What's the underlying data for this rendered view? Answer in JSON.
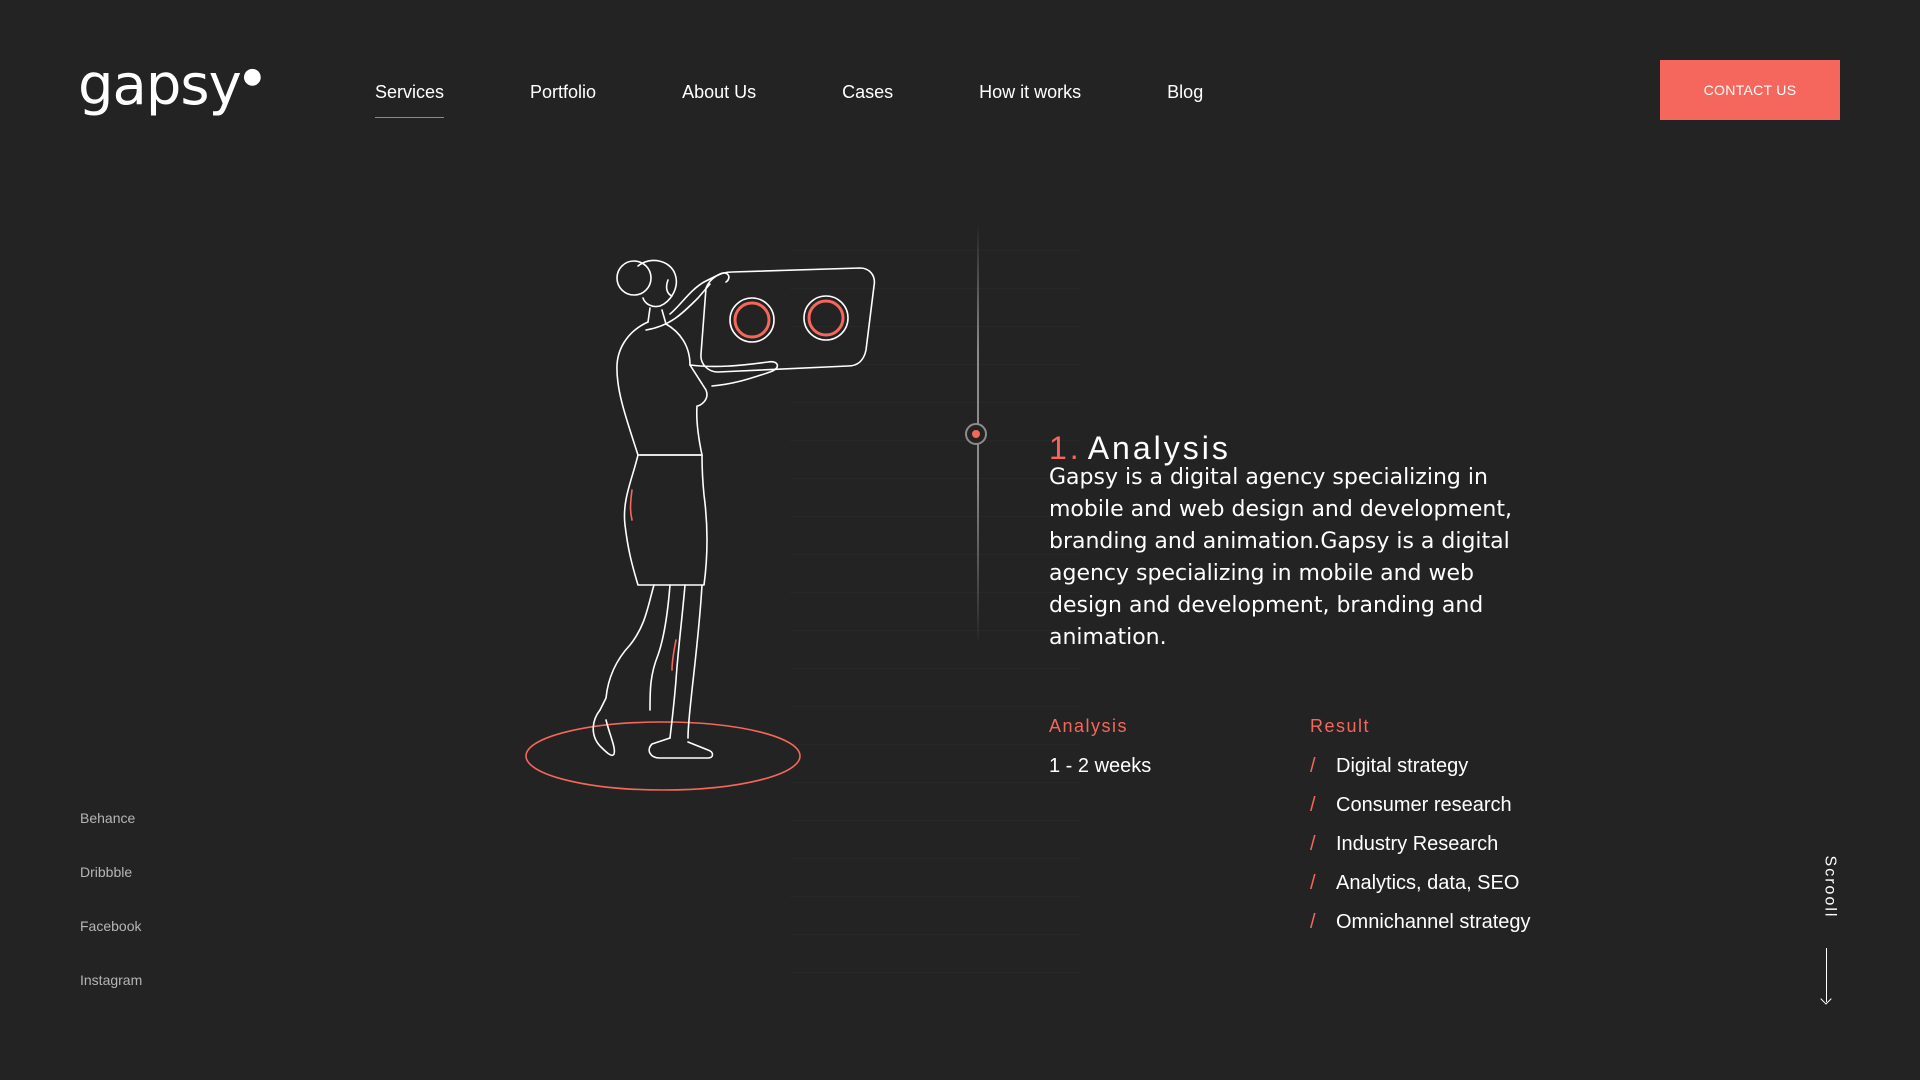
{
  "brand": {
    "logo_text": "gapsy"
  },
  "nav": {
    "items": [
      {
        "label": "Services",
        "active": true
      },
      {
        "label": "Portfolio"
      },
      {
        "label": "About Us"
      },
      {
        "label": "Cases"
      },
      {
        "label": "How it works"
      },
      {
        "label": "Blog"
      }
    ]
  },
  "header": {
    "contact_label": "CONTACT US"
  },
  "social": {
    "items": [
      {
        "label": "Behance"
      },
      {
        "label": "Dribbble"
      },
      {
        "label": "Facebook"
      },
      {
        "label": "Instagram"
      }
    ]
  },
  "step": {
    "number": "1.",
    "title": "Analysis",
    "description": "Gapsy is a digital agency specializing in mobile and web design and development, branding and animation.Gapsy is a digital agency specializing in mobile and web design and development, branding and animation.",
    "analysis_label": "Analysis",
    "duration": "1 - 2 weeks",
    "result_label": "Result",
    "results": [
      "Digital strategy",
      "Consumer research",
      "Industry Research",
      "Analytics, data, SEO",
      "Omnichannel strategy"
    ],
    "result_bullet": "/"
  },
  "scroll": {
    "label": "Scrooll"
  },
  "colors": {
    "accent": "#f5675c",
    "background": "#232323",
    "text": "#ffffff"
  }
}
